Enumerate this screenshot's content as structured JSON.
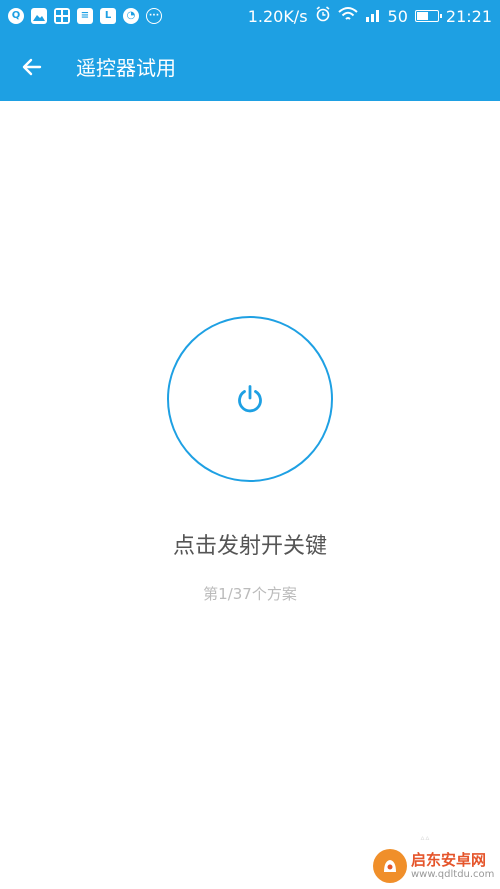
{
  "status_bar": {
    "notification_icons": [
      "qq-icon",
      "image-icon",
      "app-grid-icon",
      "news-icon",
      "letter-l-icon",
      "chrome-icon",
      "more-dots-icon"
    ],
    "network_speed": "1.20K/s",
    "signal_label": "50",
    "battery_level": 0.5,
    "time": "21:21"
  },
  "header": {
    "title": "遥控器试用",
    "back_icon": "arrow-left-icon"
  },
  "main": {
    "power_icon": "power-icon",
    "hint": "点击发射开关键",
    "progress": "第1/37个方案"
  },
  "watermark": {
    "name": "启东安卓网",
    "url": "www.qdltdu.com"
  },
  "colors": {
    "primary": "#1ea0e3",
    "text": "#555555",
    "subtext": "#bbbbbb"
  }
}
